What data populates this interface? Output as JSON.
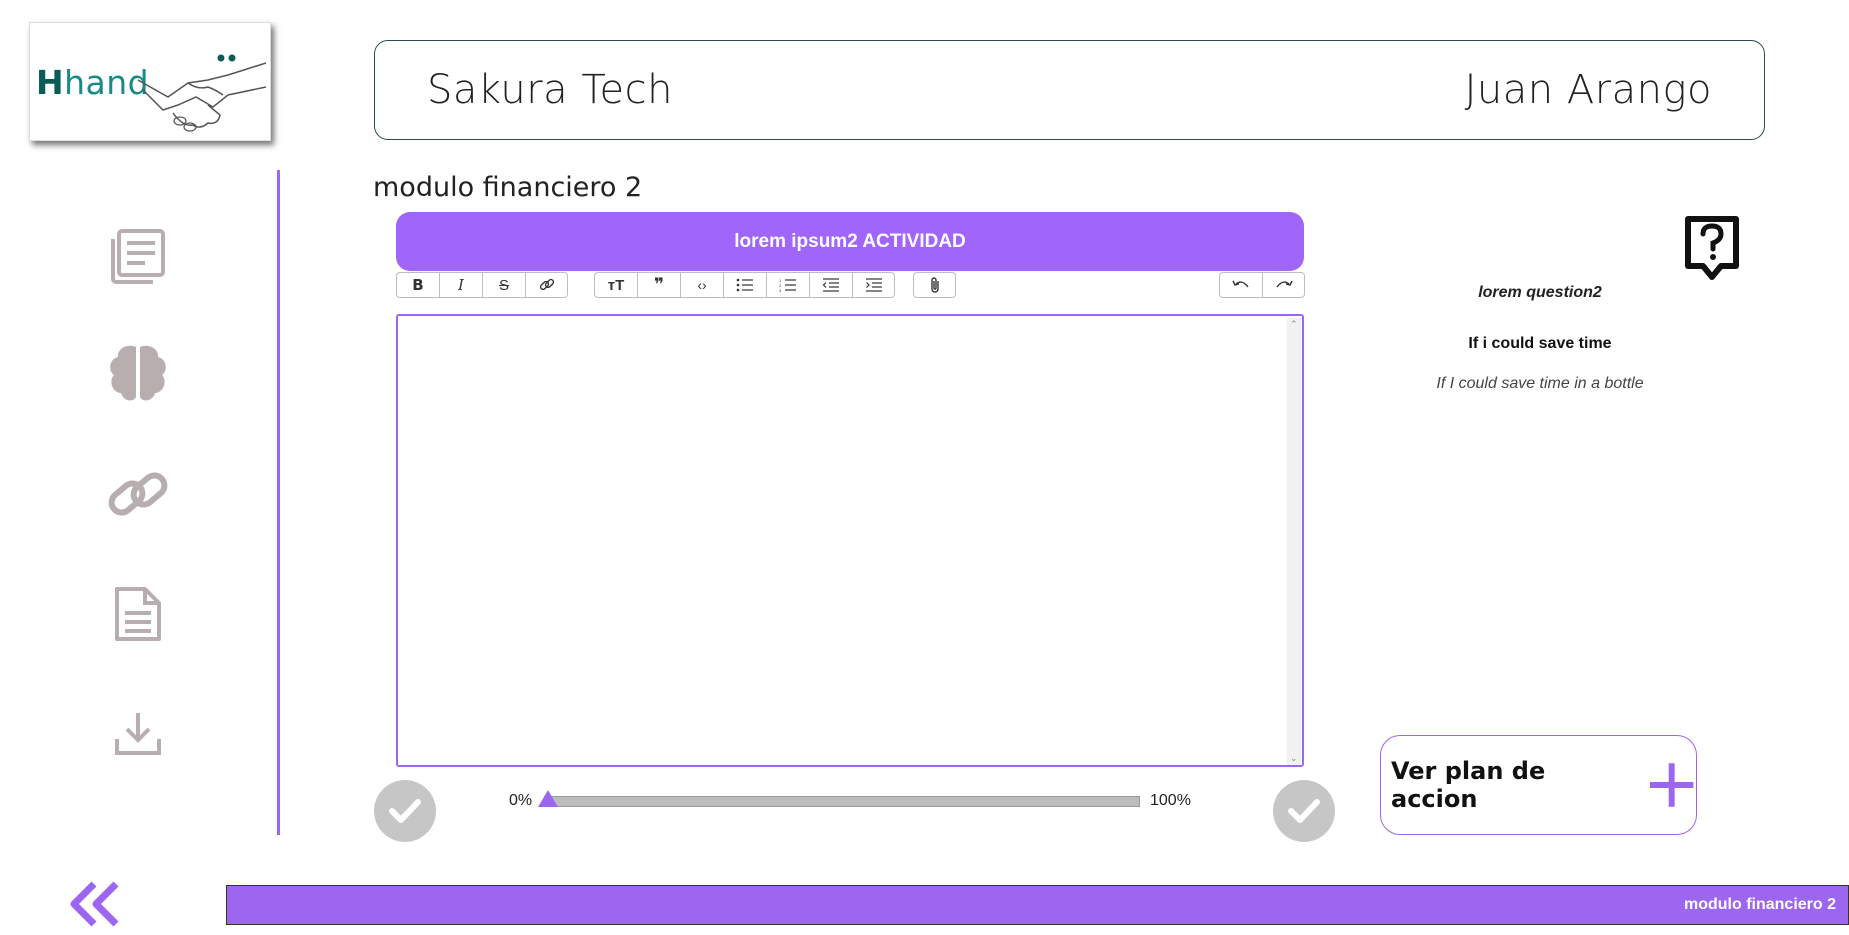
{
  "logo": {
    "text_h": "H",
    "text_rest": "hand"
  },
  "header": {
    "company": "Sakura Tech",
    "user": "Juan Arango"
  },
  "module": {
    "title": "modulo financiero 2"
  },
  "activity": {
    "title": "lorem ipsum2 ACTIVIDAD"
  },
  "toolbar": {
    "bold": "B",
    "italic": "I",
    "strike": "S",
    "heading": "тТ",
    "quote": "❞",
    "code": "‹›"
  },
  "editor": {
    "value": "",
    "placeholder": ""
  },
  "progress": {
    "min_label": "0%",
    "max_label": "100%",
    "value_percent": 0
  },
  "side": {
    "question": "lorem question2",
    "answer_title": "If i could save time",
    "answer_text": "If I could save time in a bottle"
  },
  "plan_button": {
    "label": "Ver plan de accion"
  },
  "footer": {
    "label": "modulo financiero 2"
  },
  "colors": {
    "accent": "#9d66f0",
    "banner": "#a066fa",
    "icon_gray": "#b8aeb0",
    "check_gray": "#c6c6c6"
  },
  "icons": [
    "newspaper-icon",
    "brain-icon",
    "link-icon",
    "document-icon",
    "download-icon",
    "help-question-icon",
    "plus-icon",
    "double-chevron-left-icon",
    "check-icon"
  ]
}
